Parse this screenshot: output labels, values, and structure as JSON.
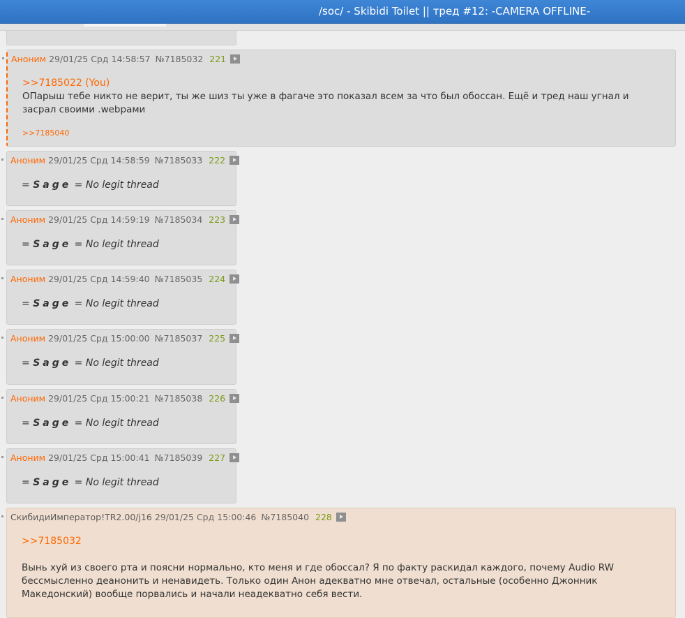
{
  "topbar": {
    "title": "/soc/ - Skibidi Toilet || тред #12: -CAMERA OFFLINE-"
  },
  "posts": [
    {
      "name": "Аноним",
      "datetime": "29/01/25 Срд 14:58:57",
      "number": "№7185032",
      "count": "221",
      "reply_to": ">>7185022 (You)",
      "text": "ОПарыш тебе никто не верит, ты же шиз ты уже в фагаче это показал всем за что был обоссан. Ещё и тред наш угнал и засрал своими .webрами",
      "backlink": ">>7185040"
    },
    {
      "name": "Аноним",
      "datetime": "29/01/25 Срд 14:58:59",
      "number": "№7185033",
      "count": "222",
      "sage_left": "= ",
      "sage_word": "Sage",
      "sage_right": " = No legit thread"
    },
    {
      "name": "Аноним",
      "datetime": "29/01/25 Срд 14:59:19",
      "number": "№7185034",
      "count": "223",
      "sage_left": "= ",
      "sage_word": "Sage",
      "sage_right": " = No legit thread"
    },
    {
      "name": "Аноним",
      "datetime": "29/01/25 Срд 14:59:40",
      "number": "№7185035",
      "count": "224",
      "sage_left": "= ",
      "sage_word": "Sage",
      "sage_right": " = No legit thread"
    },
    {
      "name": "Аноним",
      "datetime": "29/01/25 Срд 15:00:00",
      "number": "№7185037",
      "count": "225",
      "sage_left": "= ",
      "sage_word": "Sage",
      "sage_right": " = No legit thread"
    },
    {
      "name": "Аноним",
      "datetime": "29/01/25 Срд 15:00:21",
      "number": "№7185038",
      "count": "226",
      "sage_left": "= ",
      "sage_word": "Sage",
      "sage_right": " = No legit thread"
    },
    {
      "name": "Аноним",
      "datetime": "29/01/25 Срд 15:00:41",
      "number": "№7185039",
      "count": "227",
      "sage_left": "= ",
      "sage_word": "Sage",
      "sage_right": " = No legit thread"
    },
    {
      "name": "СкибидиИмператор!TR2.00/j16",
      "datetime": "29/01/25 Срд 15:00:46",
      "number": "№7185040",
      "count": "228",
      "reply_to": ">>7185032",
      "text": "Вынь хуй из своего рта и поясни нормально, кто меня и где обоссал? Я по факту раскидал каждого, почему Audio RW бессмысленно деанонить и ненавидеть. Только один Анон адекватно мне отвечал, остальные (особенно Джонник Македонский) вообще порвались и начали неадекватно себя вести."
    }
  ],
  "colors": {
    "topbar": "#3a7fd0",
    "name": "#ff6600",
    "count": "#7a9a16",
    "op_bg": "#f0dfd0",
    "post_bg": "#dddddd"
  },
  "icons": {
    "media": "play-icon"
  }
}
